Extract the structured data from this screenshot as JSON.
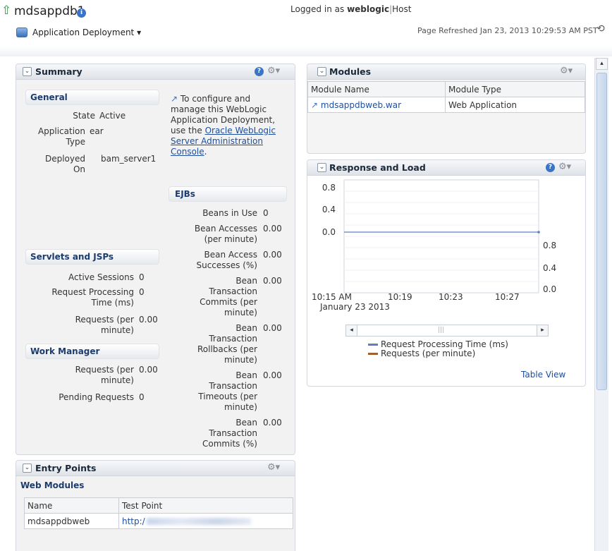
{
  "header": {
    "app_name": "mdsappdb1",
    "menu_label": "Application Deployment",
    "logged_in_prefix": "Logged in as",
    "username": "weblogic",
    "separator": "|",
    "host_label": "Host",
    "refresh_text": "Page Refreshed Jan 23, 2013 10:29:53 AM PST"
  },
  "summary": {
    "title": "Summary",
    "general": {
      "title": "General",
      "state_label": "State",
      "state_value": "Active",
      "app_type_label_1": "Application",
      "app_type_label_2": "Type",
      "app_type_value": "ear",
      "deployed_label_1": "Deployed",
      "deployed_label_2": "On",
      "deployed_value": "bam_server1"
    },
    "config_note": {
      "line1": "To configure and",
      "line2": "manage this WebLogic",
      "line3": "Application Deployment,",
      "line4": "use the",
      "link1": "Oracle WebLogic",
      "link2": "Server Administration",
      "link3": "Console",
      "end": "."
    },
    "servlets": {
      "title": "Servlets and JSPs",
      "active_label": "Active Sessions",
      "active_value": "0",
      "rpt_label_1": "Request Processing",
      "rpt_label_2": "Time (ms)",
      "rpt_value": "0",
      "req_label_1": "Requests (per",
      "req_label_2": "minute)",
      "req_value": "0.00"
    },
    "work_manager": {
      "title": "Work Manager",
      "req_label_1": "Requests (per",
      "req_label_2": "minute)",
      "req_value": "0.00",
      "pending_label": "Pending Requests",
      "pending_value": "0"
    },
    "ejbs": {
      "title": "EJBs",
      "rows": [
        {
          "lines": [
            "Beans in Use"
          ],
          "value": "0"
        },
        {
          "lines": [
            "Bean Accesses",
            "(per minute)"
          ],
          "value": "0.00"
        },
        {
          "lines": [
            "Bean Access",
            "Successes (%)"
          ],
          "value": "0.00"
        },
        {
          "lines": [
            "Bean",
            "Transaction",
            "Commits (per",
            "minute)"
          ],
          "value": "0.00"
        },
        {
          "lines": [
            "Bean",
            "Transaction",
            "Rollbacks (per",
            "minute)"
          ],
          "value": "0.00"
        },
        {
          "lines": [
            "Bean",
            "Transaction",
            "Timeouts (per",
            "minute)"
          ],
          "value": "0.00"
        },
        {
          "lines": [
            "Bean",
            "Transaction",
            "Commits (%)"
          ],
          "value": "0.00"
        }
      ]
    }
  },
  "entry_points": {
    "title": "Entry Points",
    "section": "Web Modules",
    "col_name": "Name",
    "col_test": "Test Point",
    "row_name": "mdsappdbweb",
    "row_test": "http:/"
  },
  "modules": {
    "title": "Modules",
    "col_name": "Module Name",
    "col_type": "Module Type",
    "row_name": "mdsappdbweb.war",
    "row_type": "Web Application"
  },
  "response": {
    "title": "Response and Load",
    "table_view": "Table View"
  },
  "chart_data": {
    "type": "line",
    "y_left_ticks": [
      "0.8",
      "0.4",
      "0.0"
    ],
    "y_right_ticks": [
      "0.8",
      "0.4",
      "0.0"
    ],
    "x_ticks": [
      "10:15 AM",
      "10:19",
      "10:23",
      "10:27"
    ],
    "x_sublabel": "January 23 2013",
    "ylim": [
      0,
      1
    ],
    "series": [
      {
        "name": "Request Processing Time (ms)",
        "color": "#5a7fc4",
        "values": [
          0,
          0
        ]
      },
      {
        "name": "Requests (per minute)",
        "color": "#a0612e",
        "values": []
      }
    ]
  },
  "colors": {
    "link": "#1f4e9c",
    "section_title": "#1d3c6e",
    "help": "#3a74c6"
  }
}
